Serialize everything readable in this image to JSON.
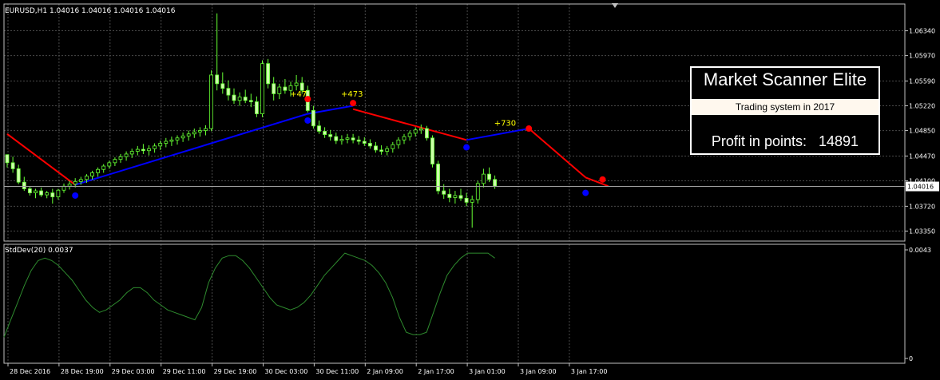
{
  "chart_data": [
    {
      "type": "candlestick",
      "title": "EURUSD,H1 1.04016 1.04016 1.04016 1.04016",
      "ylim": [
        1.032,
        1.0674
      ],
      "ticks_y": [
        "1.06340",
        "1.05970",
        "1.05590",
        "1.05220",
        "1.04850",
        "1.04470",
        "1.04100",
        "1.03720",
        "1.03350"
      ],
      "tick_values_y": [
        1.0634,
        1.0597,
        1.0559,
        1.0522,
        1.0485,
        1.0447,
        1.041,
        1.0372,
        1.0335
      ],
      "current_price_label": "1.04016",
      "current_price": 1.04016,
      "grid": true,
      "ohlc": [
        [
          1.0449,
          1.0449,
          1.043,
          1.0437
        ],
        [
          1.0437,
          1.0446,
          1.0422,
          1.0428
        ],
        [
          1.0428,
          1.0434,
          1.0405,
          1.0408
        ],
        [
          1.0408,
          1.0416,
          1.0395,
          1.0398
        ],
        [
          1.0398,
          1.0402,
          1.0388,
          1.0392
        ],
        [
          1.0392,
          1.0398,
          1.0384,
          1.0395
        ],
        [
          1.0395,
          1.04,
          1.0386,
          1.0389
        ],
        [
          1.0389,
          1.0395,
          1.0384,
          1.0392
        ],
        [
          1.0392,
          1.0398,
          1.0376,
          1.0386
        ],
        [
          1.0386,
          1.0398,
          1.0382,
          1.0396
        ],
        [
          1.0396,
          1.0406,
          1.0392,
          1.0402
        ],
        [
          1.0402,
          1.041,
          1.0397,
          1.0405
        ],
        [
          1.0405,
          1.0414,
          1.04,
          1.0409
        ],
        [
          1.0409,
          1.0416,
          1.0404,
          1.0412
        ],
        [
          1.0412,
          1.042,
          1.0407,
          1.0417
        ],
        [
          1.0417,
          1.0425,
          1.0412,
          1.0422
        ],
        [
          1.0422,
          1.043,
          1.0416,
          1.0427
        ],
        [
          1.0427,
          1.0435,
          1.0422,
          1.0432
        ],
        [
          1.0432,
          1.044,
          1.0428,
          1.0437
        ],
        [
          1.0437,
          1.0445,
          1.0432,
          1.0442
        ],
        [
          1.0442,
          1.045,
          1.0437,
          1.0446
        ],
        [
          1.0446,
          1.0454,
          1.044,
          1.045
        ],
        [
          1.045,
          1.0458,
          1.0444,
          1.0454
        ],
        [
          1.0454,
          1.0462,
          1.0448,
          1.0457
        ],
        [
          1.0457,
          1.0465,
          1.045,
          1.0455
        ],
        [
          1.0455,
          1.0463,
          1.0448,
          1.0458
        ],
        [
          1.0458,
          1.0466,
          1.0452,
          1.0462
        ],
        [
          1.0462,
          1.047,
          1.0456,
          1.0466
        ],
        [
          1.0466,
          1.0474,
          1.046,
          1.0469
        ],
        [
          1.0469,
          1.0476,
          1.0462,
          1.0471
        ],
        [
          1.0471,
          1.0478,
          1.0464,
          1.0474
        ],
        [
          1.0474,
          1.0482,
          1.0468,
          1.0477
        ],
        [
          1.0477,
          1.0485,
          1.047,
          1.048
        ],
        [
          1.048,
          1.0488,
          1.0474,
          1.0483
        ],
        [
          1.0483,
          1.049,
          1.0476,
          1.0485
        ],
        [
          1.0485,
          1.0493,
          1.0478,
          1.0488
        ],
        [
          1.0488,
          1.0575,
          1.0484,
          1.0568
        ],
        [
          1.0568,
          1.066,
          1.0545,
          1.0555
        ],
        [
          1.0555,
          1.0572,
          1.054,
          1.0548
        ],
        [
          1.0548,
          1.056,
          1.053,
          1.0538
        ],
        [
          1.0538,
          1.0548,
          1.0525,
          1.053
        ],
        [
          1.053,
          1.0542,
          1.0522,
          1.0535
        ],
        [
          1.0535,
          1.0546,
          1.0526,
          1.053
        ],
        [
          1.053,
          1.054,
          1.052,
          1.0528
        ],
        [
          1.0528,
          1.0536,
          1.0505,
          1.051
        ],
        [
          1.051,
          1.059,
          1.0505,
          1.0585
        ],
        [
          1.0585,
          1.0592,
          1.0548,
          1.0555
        ],
        [
          1.0555,
          1.0565,
          1.053,
          1.054
        ],
        [
          1.054,
          1.0555,
          1.0532,
          1.055
        ],
        [
          1.055,
          1.0562,
          1.054,
          1.0545
        ],
        [
          1.0545,
          1.0558,
          1.0536,
          1.0552
        ],
        [
          1.0552,
          1.0568,
          1.0545,
          1.0556
        ],
        [
          1.0556,
          1.0565,
          1.054,
          1.0545
        ],
        [
          1.0545,
          1.0552,
          1.0512,
          1.0515
        ],
        [
          1.0515,
          1.0522,
          1.0488,
          1.0492
        ],
        [
          1.0492,
          1.05,
          1.048,
          1.0484
        ],
        [
          1.0484,
          1.049,
          1.0474,
          1.0479
        ],
        [
          1.0479,
          1.0486,
          1.047,
          1.0476
        ],
        [
          1.0476,
          1.0482,
          1.0465,
          1.047
        ],
        [
          1.047,
          1.0478,
          1.0464,
          1.0472
        ],
        [
          1.0472,
          1.048,
          1.0466,
          1.0474
        ],
        [
          1.0474,
          1.048,
          1.0466,
          1.0471
        ],
        [
          1.0471,
          1.0477,
          1.0464,
          1.0469
        ],
        [
          1.0469,
          1.0475,
          1.0462,
          1.0466
        ],
        [
          1.0466,
          1.0472,
          1.0458,
          1.0462
        ],
        [
          1.0462,
          1.0468,
          1.0452,
          1.0456
        ],
        [
          1.0456,
          1.0463,
          1.0449,
          1.0454
        ],
        [
          1.0454,
          1.0462,
          1.0448,
          1.0458
        ],
        [
          1.0458,
          1.0468,
          1.0452,
          1.0464
        ],
        [
          1.0464,
          1.0475,
          1.0458,
          1.0471
        ],
        [
          1.0471,
          1.048,
          1.0465,
          1.0476
        ],
        [
          1.0476,
          1.0485,
          1.047,
          1.0481
        ],
        [
          1.0481,
          1.049,
          1.0476,
          1.0486
        ],
        [
          1.0486,
          1.0494,
          1.048,
          1.0488
        ],
        [
          1.0488,
          1.0492,
          1.047,
          1.0474
        ],
        [
          1.0474,
          1.0478,
          1.043,
          1.0435
        ],
        [
          1.0435,
          1.044,
          1.039,
          1.0395
        ],
        [
          1.0395,
          1.0405,
          1.0383,
          1.039
        ],
        [
          1.039,
          1.0398,
          1.0378,
          1.0385
        ],
        [
          1.0385,
          1.0395,
          1.0376,
          1.0388
        ],
        [
          1.0388,
          1.0398,
          1.038,
          1.0384
        ],
        [
          1.0384,
          1.0392,
          1.0372,
          1.0378
        ],
        [
          1.0378,
          1.0388,
          1.034,
          1.0382
        ],
        [
          1.0382,
          1.041,
          1.0376,
          1.0406
        ],
        [
          1.0406,
          1.0428,
          1.04,
          1.042
        ],
        [
          1.042,
          1.043,
          1.0408,
          1.0412
        ],
        [
          1.0412,
          1.0418,
          1.0398,
          1.0402
        ]
      ],
      "trend_segments": [
        {
          "from": 0,
          "to": 12,
          "y_from": 1.048,
          "y_to": 1.0404,
          "direction": "down",
          "color": "#ff0000"
        },
        {
          "from": 12,
          "to": 53,
          "y_from": 1.0404,
          "y_to": 1.051,
          "direction": "up",
          "color": "#0000ff"
        },
        {
          "from": 53,
          "to": 61,
          "y_from": 1.051,
          "y_to": 1.0522,
          "direction": "up",
          "color": "#0000ff"
        },
        {
          "from": 61,
          "to": 81,
          "y_from": 1.0517,
          "y_to": 1.0471,
          "direction": "down",
          "color": "#ff0000"
        },
        {
          "from": 81,
          "to": 92,
          "y_from": 1.0471,
          "y_to": 1.0488,
          "direction": "up",
          "color": "#0000ff"
        },
        {
          "from": 92,
          "to": 102,
          "y_from": 1.0488,
          "y_to": 1.0415,
          "direction": "down",
          "color": "#ff0000"
        },
        {
          "from": 102,
          "to": 106,
          "y_from": 1.0415,
          "y_to": 1.0402,
          "direction": "down",
          "color": "#ff0000"
        }
      ],
      "signals": [
        {
          "index": 12,
          "price": 1.0388,
          "color": "#0000ff"
        },
        {
          "index": 53,
          "price": 1.05,
          "color": "#0000ff"
        },
        {
          "index": 53,
          "price": 1.0532,
          "color": "#ff0000"
        },
        {
          "index": 61,
          "price": 1.0526,
          "color": "#ff0000"
        },
        {
          "index": 81,
          "price": 1.046,
          "color": "#0000ff"
        },
        {
          "index": 92,
          "price": 1.0488,
          "color": "#ff0000"
        },
        {
          "index": 102,
          "price": 1.0392,
          "color": "#0000ff"
        },
        {
          "index": 105,
          "price": 1.0412,
          "color": "#ff0000"
        }
      ],
      "trade_labels": [
        {
          "text": "+47",
          "index": 51,
          "price": 1.0536,
          "color": "#ffff00"
        },
        {
          "text": "+473",
          "index": 60,
          "price": 1.0536,
          "color": "#ffff00"
        },
        {
          "text": "+730",
          "index": 87,
          "price": 1.0492,
          "color": "#ffff00"
        }
      ]
    },
    {
      "type": "line",
      "title": "StdDev(20) 0.0037",
      "ylim": [
        0,
        0.0043
      ],
      "ticks_y": [
        "0.0043",
        "0"
      ],
      "tick_values_y": [
        0.0043,
        0
      ],
      "series": [
        {
          "color": "#2e8b2e",
          "values": [
            0.0008,
            0.0015,
            0.0022,
            0.0029,
            0.0035,
            0.0039,
            0.004,
            0.0039,
            0.0037,
            0.0034,
            0.0031,
            0.0027,
            0.0023,
            0.002,
            0.0018,
            0.0019,
            0.0021,
            0.0023,
            0.0026,
            0.0028,
            0.0028,
            0.0026,
            0.0023,
            0.0021,
            0.0019,
            0.0018,
            0.0017,
            0.0016,
            0.0015,
            0.002,
            0.003,
            0.0036,
            0.004,
            0.0041,
            0.0041,
            0.0039,
            0.0036,
            0.0032,
            0.0028,
            0.0024,
            0.0021,
            0.002,
            0.0019,
            0.002,
            0.0022,
            0.0025,
            0.0029,
            0.0033,
            0.0036,
            0.0039,
            0.0042,
            0.0041,
            0.004,
            0.0039,
            0.0037,
            0.0034,
            0.003,
            0.0024,
            0.0016,
            0.001,
            0.0009,
            0.0009,
            0.001,
            0.0018,
            0.0026,
            0.0033,
            0.0037,
            0.004,
            0.0042,
            0.0042,
            0.0042,
            0.0042,
            0.004
          ]
        }
      ]
    }
  ],
  "x_ticks": [
    "28 Dec 2016",
    "28 Dec 19:00",
    "29 Dec 03:00",
    "29 Dec 11:00",
    "29 Dec 19:00",
    "30 Dec 03:00",
    "30 Dec 11:00",
    "2 Jan 09:00",
    "2 Jan 17:00",
    "3 Jan 01:00",
    "3 Jan 09:00",
    "3 Jan 17:00"
  ],
  "x_tick_indices": [
    0,
    9,
    18,
    27,
    36,
    45,
    54,
    63,
    72,
    81,
    90,
    99
  ],
  "panel": {
    "title": "Market Scanner Elite",
    "subtitle": "Trading system in 2017",
    "profit_label": "Profit in points:",
    "profit_value": "14891"
  },
  "colors": {
    "background": "#000000",
    "grid": "#4a4a4a",
    "frame": "#c0c0c0",
    "bull_candle": "#000000",
    "bear_candle": "#ccffaa",
    "candle_outline": "#66ff33",
    "text": "#ffffff"
  }
}
